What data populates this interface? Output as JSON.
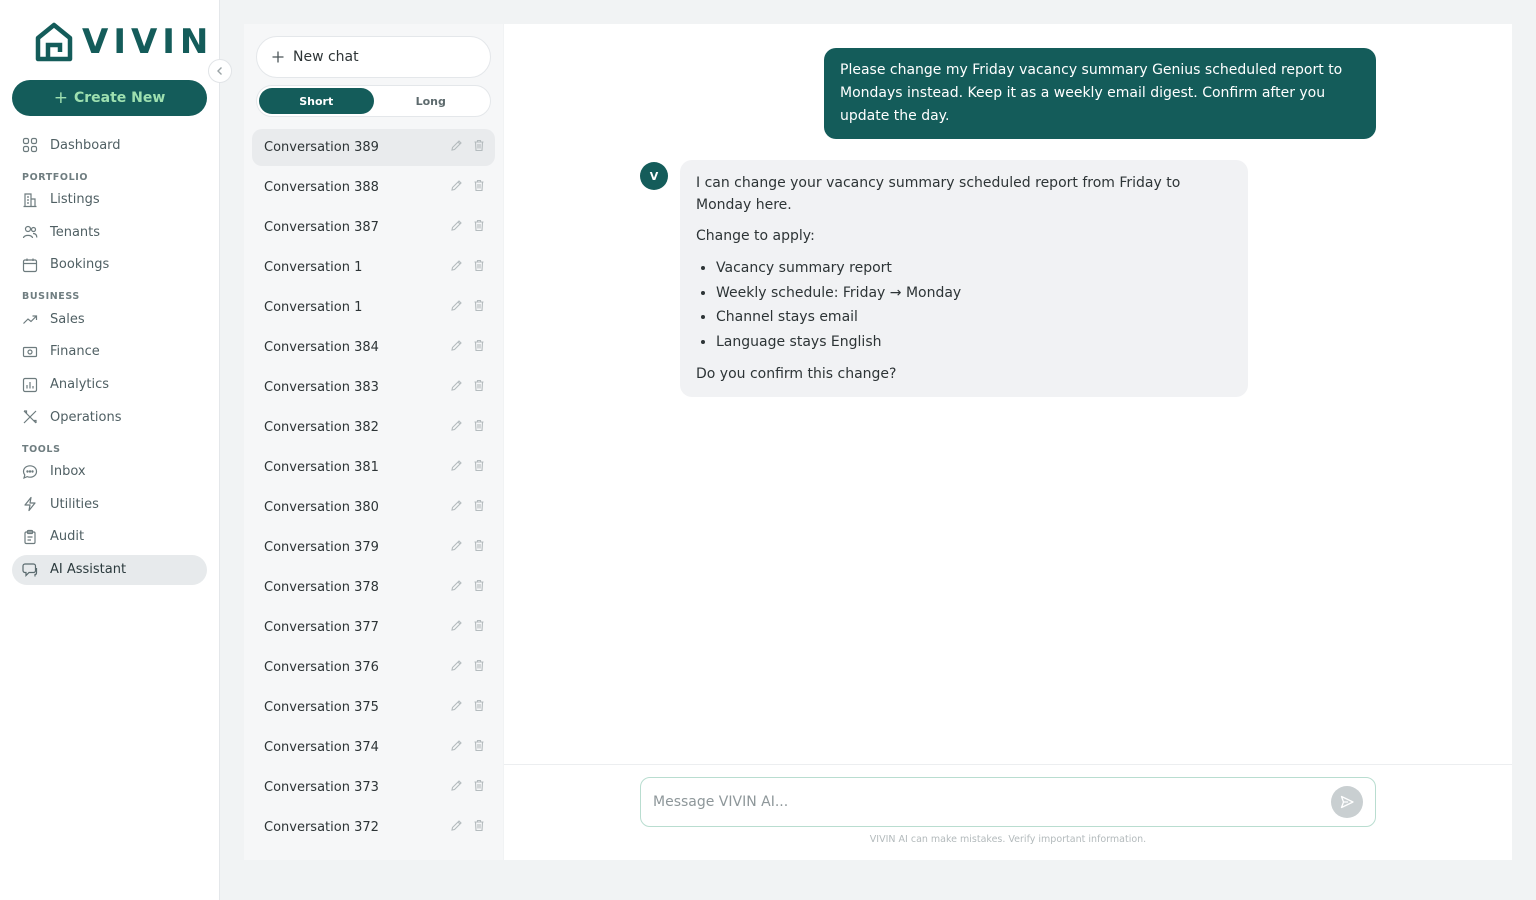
{
  "app": {
    "logo_text": "VIVIN",
    "create_button": "Create New"
  },
  "nav": {
    "dashboard": "Dashboard",
    "section_portfolio": "PORTFOLIO",
    "listings": "Listings",
    "tenants": "Tenants",
    "bookings": "Bookings",
    "section_business": "BUSINESS",
    "sales": "Sales",
    "finance": "Finance",
    "analytics": "Analytics",
    "operations": "Operations",
    "section_tools": "TOOLS",
    "inbox": "Inbox",
    "utilities": "Utilities",
    "audit": "Audit",
    "ai_assistant": "AI Assistant"
  },
  "conversations": {
    "new_chat": "New chat",
    "toggle_short": "Short",
    "toggle_long": "Long",
    "items": [
      "Conversation 389",
      "Conversation 388",
      "Conversation 387",
      "Conversation 1",
      "Conversation 1",
      "Conversation 384",
      "Conversation 383",
      "Conversation 382",
      "Conversation 381",
      "Conversation 380",
      "Conversation 379",
      "Conversation 378",
      "Conversation 377",
      "Conversation 376",
      "Conversation 375",
      "Conversation 374",
      "Conversation 373",
      "Conversation 372"
    ]
  },
  "chat": {
    "user_message": "Please change my Friday vacancy summary Genius scheduled report to Mondays instead. Keep it as a weekly email digest. Confirm after you update the day.",
    "bot_avatar": "V",
    "bot_intro": "I can change your vacancy summary scheduled report from Friday to Monday here.",
    "bot_change_heading": "Change to apply:",
    "bot_changes": [
      "Vacancy summary report",
      "Weekly schedule: Friday → Monday",
      "Channel stays email",
      "Language stays English"
    ],
    "bot_question": "Do you confirm this change?",
    "composer_placeholder": "Message VIVIN AI...",
    "disclaimer": "VIVIN AI can make mistakes. Verify important information."
  },
  "colors": {
    "brand": "#145c5a",
    "brand_accent": "#9ee0b0"
  }
}
